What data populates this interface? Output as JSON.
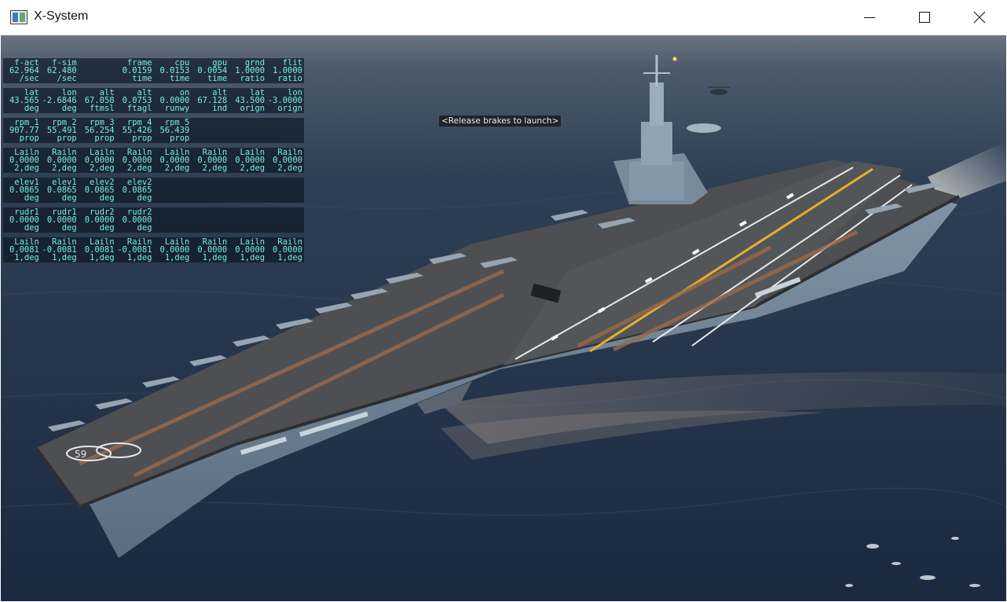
{
  "window": {
    "title": "X-System",
    "controls": {
      "minimize": "minimize",
      "maximize": "maximize",
      "close": "close"
    }
  },
  "viewport": {
    "message": "<Release brakes to launch>",
    "deck_number": "59"
  },
  "data_output": [
    [
      [
        "f-act",
        "62.964",
        "/sec"
      ],
      [
        "f-sim",
        "62.480",
        "/sec"
      ],
      [
        "",
        "",
        ""
      ],
      [
        "frame",
        "0.0159",
        "time"
      ],
      [
        "cpu",
        "0.0153",
        "time"
      ],
      [
        "gpu",
        "0.0054",
        "time"
      ],
      [
        "grnd",
        "1.0000",
        "ratio"
      ],
      [
        "flit",
        "1.0000",
        "ratio"
      ]
    ],
    [
      [
        "lat",
        "43.565",
        "deg"
      ],
      [
        "lon",
        "-2.6846",
        "deg"
      ],
      [
        "alt",
        "67.058",
        "ftmsl"
      ],
      [
        "alt",
        "0.0753",
        "ftagl"
      ],
      [
        "on",
        "0.0000",
        "runwy"
      ],
      [
        "alt",
        "67.128",
        "ind"
      ],
      [
        "lat",
        "43.500",
        "orign"
      ],
      [
        "lon",
        "-3.0000",
        "orign"
      ]
    ],
    [
      [
        "rpm 1",
        "907.77",
        "prop"
      ],
      [
        "rpm 2",
        "55.491",
        "prop"
      ],
      [
        "rpm 3",
        "56.254",
        "prop"
      ],
      [
        "rpm 4",
        "55.426",
        "prop"
      ],
      [
        "rpm 5",
        "56.439",
        "prop"
      ],
      [
        "",
        "",
        ""
      ],
      [
        "",
        "",
        ""
      ],
      [
        "",
        "",
        ""
      ]
    ],
    [
      [
        "Lailn",
        "0.0000",
        "2,deg"
      ],
      [
        "Railn",
        "0.0000",
        "2,deg"
      ],
      [
        "Lailn",
        "0.0000",
        "2,deg"
      ],
      [
        "Railn",
        "0.0000",
        "2,deg"
      ],
      [
        "Lailn",
        "0.0000",
        "2,deg"
      ],
      [
        "Railn",
        "0.0000",
        "2,deg"
      ],
      [
        "Lailn",
        "0.0000",
        "2,deg"
      ],
      [
        "Railn",
        "0.0000",
        "2,deg"
      ]
    ],
    [
      [
        "elev1",
        "0.0865",
        "deg"
      ],
      [
        "elev1",
        "0.0865",
        "deg"
      ],
      [
        "elev2",
        "0.0865",
        "deg"
      ],
      [
        "elev2",
        "0.0865",
        "deg"
      ],
      [
        "",
        "",
        ""
      ],
      [
        "",
        "",
        ""
      ],
      [
        "",
        "",
        ""
      ],
      [
        "",
        "",
        ""
      ]
    ],
    [
      [
        "rudr1",
        "0.0000",
        "deg"
      ],
      [
        "rudr1",
        "0.0000",
        "deg"
      ],
      [
        "rudr2",
        "0.0000",
        "deg"
      ],
      [
        "rudr2",
        "0.0000",
        "deg"
      ],
      [
        "",
        "",
        ""
      ],
      [
        "",
        "",
        ""
      ],
      [
        "",
        "",
        ""
      ],
      [
        "",
        "",
        ""
      ]
    ],
    [
      [
        "Lailn",
        "0.0081",
        "1,deg"
      ],
      [
        "Railn",
        "-0.0081",
        "1,deg"
      ],
      [
        "Lailn",
        "0.0081",
        "1,deg"
      ],
      [
        "Railn",
        "-0.0081",
        "1,deg"
      ],
      [
        "Lailn",
        "0.0000",
        "1,deg"
      ],
      [
        "Railn",
        "0.0000",
        "1,deg"
      ],
      [
        "Lailn",
        "0.0000",
        "1,deg"
      ],
      [
        "Railn",
        "0.0000",
        "1,deg"
      ]
    ]
  ],
  "colors": {
    "data_text": "#79ece0",
    "sea": "#24344a",
    "hull": "#6b7f93",
    "deck": "#4d4f52"
  },
  "icons": {
    "app": "xplane-window-icon",
    "minimize": "minimize-icon",
    "maximize": "maximize-icon",
    "close": "close-icon"
  }
}
